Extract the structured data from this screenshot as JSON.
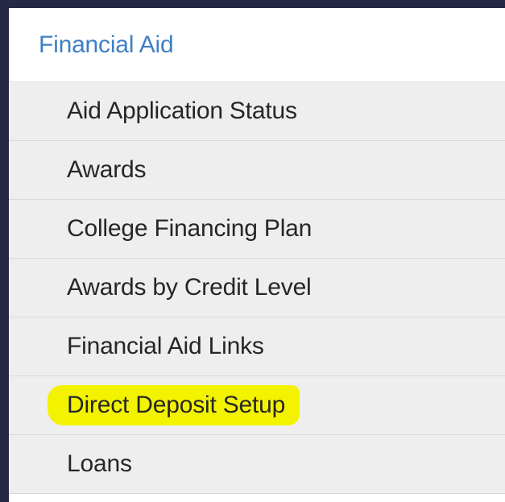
{
  "menu": {
    "header_label": "Financial Aid",
    "items": [
      {
        "label": "Aid Application Status"
      },
      {
        "label": "Awards"
      },
      {
        "label": "College Financing Plan"
      },
      {
        "label": "Awards by Credit Level"
      },
      {
        "label": "Financial Aid Links"
      },
      {
        "label": "Direct Deposit Setup",
        "highlighted": true
      },
      {
        "label": "Loans"
      }
    ]
  },
  "colors": {
    "background": "#262846",
    "header_link": "#3f7fc4",
    "item_background": "#eeeeee",
    "highlight": "#f3f300"
  }
}
